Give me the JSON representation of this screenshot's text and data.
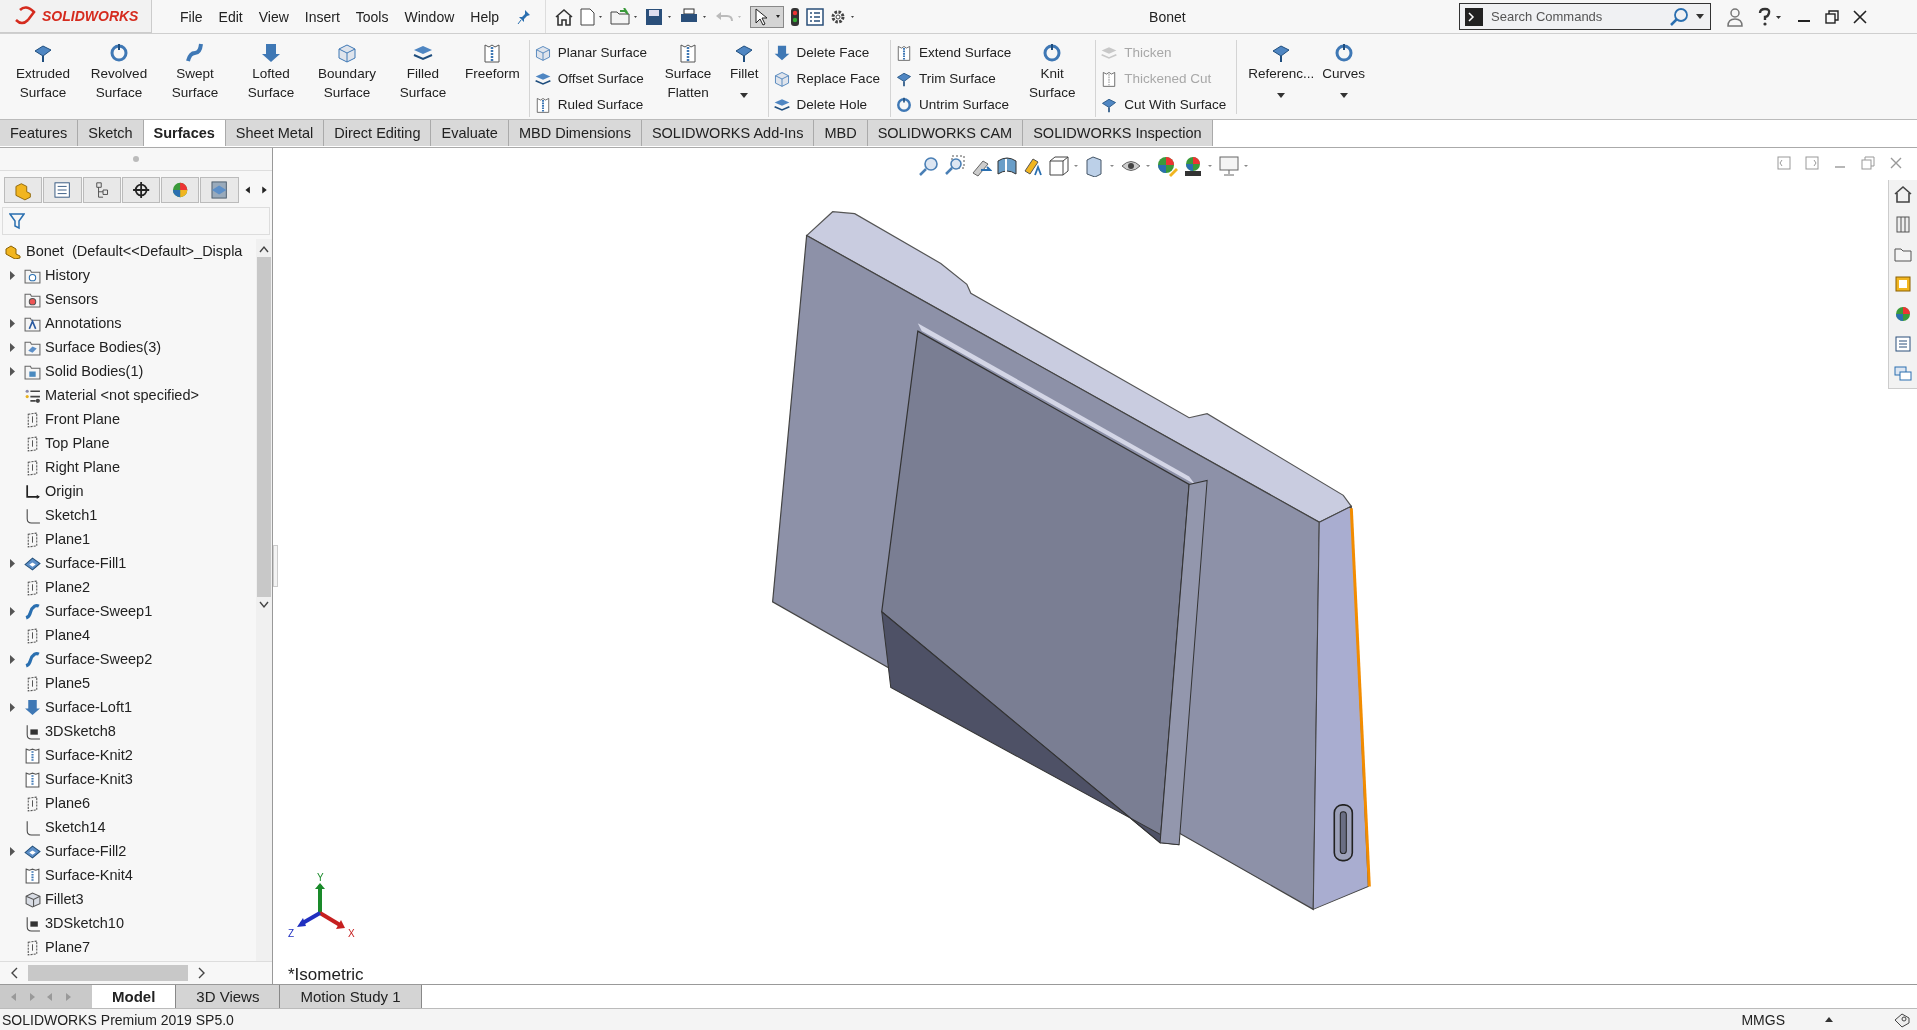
{
  "app": {
    "logo": "SOLIDWORKS",
    "menu": [
      "File",
      "Edit",
      "View",
      "Insert",
      "Tools",
      "Window",
      "Help"
    ],
    "title": "Bonet",
    "search": {
      "placeholder": "Search Commands"
    }
  },
  "ribbon": {
    "groups": [
      {
        "kind": "large",
        "divider_before": false,
        "buttons": [
          {
            "label": "Extruded Surface",
            "dropdown": false
          },
          {
            "label": "Revolved Surface",
            "dropdown": false
          },
          {
            "label": "Swept Surface",
            "dropdown": false
          },
          {
            "label": "Lofted Surface",
            "dropdown": false
          },
          {
            "label": "Boundary Surface",
            "dropdown": false
          },
          {
            "label": "Filled Surface",
            "dropdown": false
          },
          {
            "label": "Freeform",
            "dropdown": false
          }
        ]
      },
      {
        "kind": "stack",
        "divider_before": true,
        "items": [
          {
            "label": "Planar Surface",
            "disabled": false
          },
          {
            "label": "Offset Surface",
            "disabled": false
          },
          {
            "label": "Ruled Surface",
            "disabled": false
          }
        ]
      },
      {
        "kind": "large",
        "divider_before": false,
        "buttons": [
          {
            "label": "Surface Flatten",
            "dropdown": false
          },
          {
            "label": "Fillet",
            "dropdown": true
          }
        ]
      },
      {
        "kind": "stack",
        "divider_before": true,
        "items": [
          {
            "label": "Delete Face",
            "disabled": false
          },
          {
            "label": "Replace Face",
            "disabled": false
          },
          {
            "label": "Delete Hole",
            "disabled": false
          }
        ]
      },
      {
        "kind": "stack",
        "divider_before": true,
        "items": [
          {
            "label": "Extend Surface",
            "disabled": false
          },
          {
            "label": "Trim Surface",
            "disabled": false
          },
          {
            "label": "Untrim Surface",
            "disabled": false
          }
        ]
      },
      {
        "kind": "large",
        "divider_before": false,
        "buttons": [
          {
            "label": "Knit Surface",
            "dropdown": false
          }
        ]
      },
      {
        "kind": "stack",
        "divider_before": true,
        "items": [
          {
            "label": "Thicken",
            "disabled": true
          },
          {
            "label": "Thickened Cut",
            "disabled": true
          },
          {
            "label": "Cut With Surface",
            "disabled": false
          }
        ]
      },
      {
        "kind": "large",
        "divider_before": true,
        "buttons": [
          {
            "label": "Referenc...",
            "dropdown": true
          },
          {
            "label": "Curves",
            "dropdown": true
          }
        ]
      }
    ]
  },
  "command_tabs": [
    {
      "label": "Features",
      "selected": false
    },
    {
      "label": "Sketch",
      "selected": false
    },
    {
      "label": "Surfaces",
      "selected": true
    },
    {
      "label": "Sheet Metal",
      "selected": false
    },
    {
      "label": "Direct Editing",
      "selected": false
    },
    {
      "label": "Evaluate",
      "selected": false
    },
    {
      "label": "MBD Dimensions",
      "selected": false
    },
    {
      "label": "SOLIDWORKS Add-Ins",
      "selected": false
    },
    {
      "label": "MBD",
      "selected": false
    },
    {
      "label": "SOLIDWORKS CAM",
      "selected": false
    },
    {
      "label": "SOLIDWORKS Inspection",
      "selected": false
    }
  ],
  "feature_tree": {
    "root": "Bonet  (Default<<Default>_Displa",
    "items": [
      {
        "label": "History",
        "kind": "history",
        "expandable": true
      },
      {
        "label": "Sensors",
        "kind": "sensors",
        "expandable": false
      },
      {
        "label": "Annotations",
        "kind": "annotations",
        "expandable": true
      },
      {
        "label": "Surface Bodies(3)",
        "kind": "surface-bodies",
        "expandable": true
      },
      {
        "label": "Solid Bodies(1)",
        "kind": "solid-bodies",
        "expandable": true
      },
      {
        "label": "Material <not specified>",
        "kind": "material",
        "expandable": false
      },
      {
        "label": "Front Plane",
        "kind": "plane",
        "expandable": false
      },
      {
        "label": "Top Plane",
        "kind": "plane",
        "expandable": false
      },
      {
        "label": "Right Plane",
        "kind": "plane",
        "expandable": false
      },
      {
        "label": "Origin",
        "kind": "origin",
        "expandable": false
      },
      {
        "label": "Sketch1",
        "kind": "sketch",
        "expandable": false
      },
      {
        "label": "Plane1",
        "kind": "plane",
        "expandable": false
      },
      {
        "label": "Surface-Fill1",
        "kind": "fill",
        "expandable": true
      },
      {
        "label": "Plane2",
        "kind": "plane",
        "expandable": false
      },
      {
        "label": "Surface-Sweep1",
        "kind": "sweep",
        "expandable": true
      },
      {
        "label": "Plane4",
        "kind": "plane",
        "expandable": false
      },
      {
        "label": "Surface-Sweep2",
        "kind": "sweep",
        "expandable": true
      },
      {
        "label": "Plane5",
        "kind": "plane",
        "expandable": false
      },
      {
        "label": "Surface-Loft1",
        "kind": "loft",
        "expandable": true
      },
      {
        "label": "3DSketch8",
        "kind": "sketch3d",
        "expandable": false
      },
      {
        "label": "Surface-Knit2",
        "kind": "knit",
        "expandable": false
      },
      {
        "label": "Surface-Knit3",
        "kind": "knit",
        "expandable": false
      },
      {
        "label": "Plane6",
        "kind": "plane",
        "expandable": false
      },
      {
        "label": "Sketch14",
        "kind": "sketch",
        "expandable": false
      },
      {
        "label": "Surface-Fill2",
        "kind": "fill",
        "expandable": true
      },
      {
        "label": "Surface-Knit4",
        "kind": "knit",
        "expandable": false
      },
      {
        "label": "Fillet3",
        "kind": "fillet",
        "expandable": false
      },
      {
        "label": "3DSketch10",
        "kind": "sketch3d",
        "expandable": false
      },
      {
        "label": "Plane7",
        "kind": "plane",
        "expandable": false
      }
    ]
  },
  "viewport": {
    "view_name": "*Isometric",
    "triad": {
      "x": "X",
      "y": "Y",
      "z": "Z"
    }
  },
  "bottom_tabs": [
    {
      "label": "Model",
      "selected": true
    },
    {
      "label": "3D Views",
      "selected": false
    },
    {
      "label": "Motion Study 1",
      "selected": false
    }
  ],
  "status_bar": {
    "product": "SOLIDWORKS Premium 2019 SP5.0",
    "units": "MMGS"
  }
}
